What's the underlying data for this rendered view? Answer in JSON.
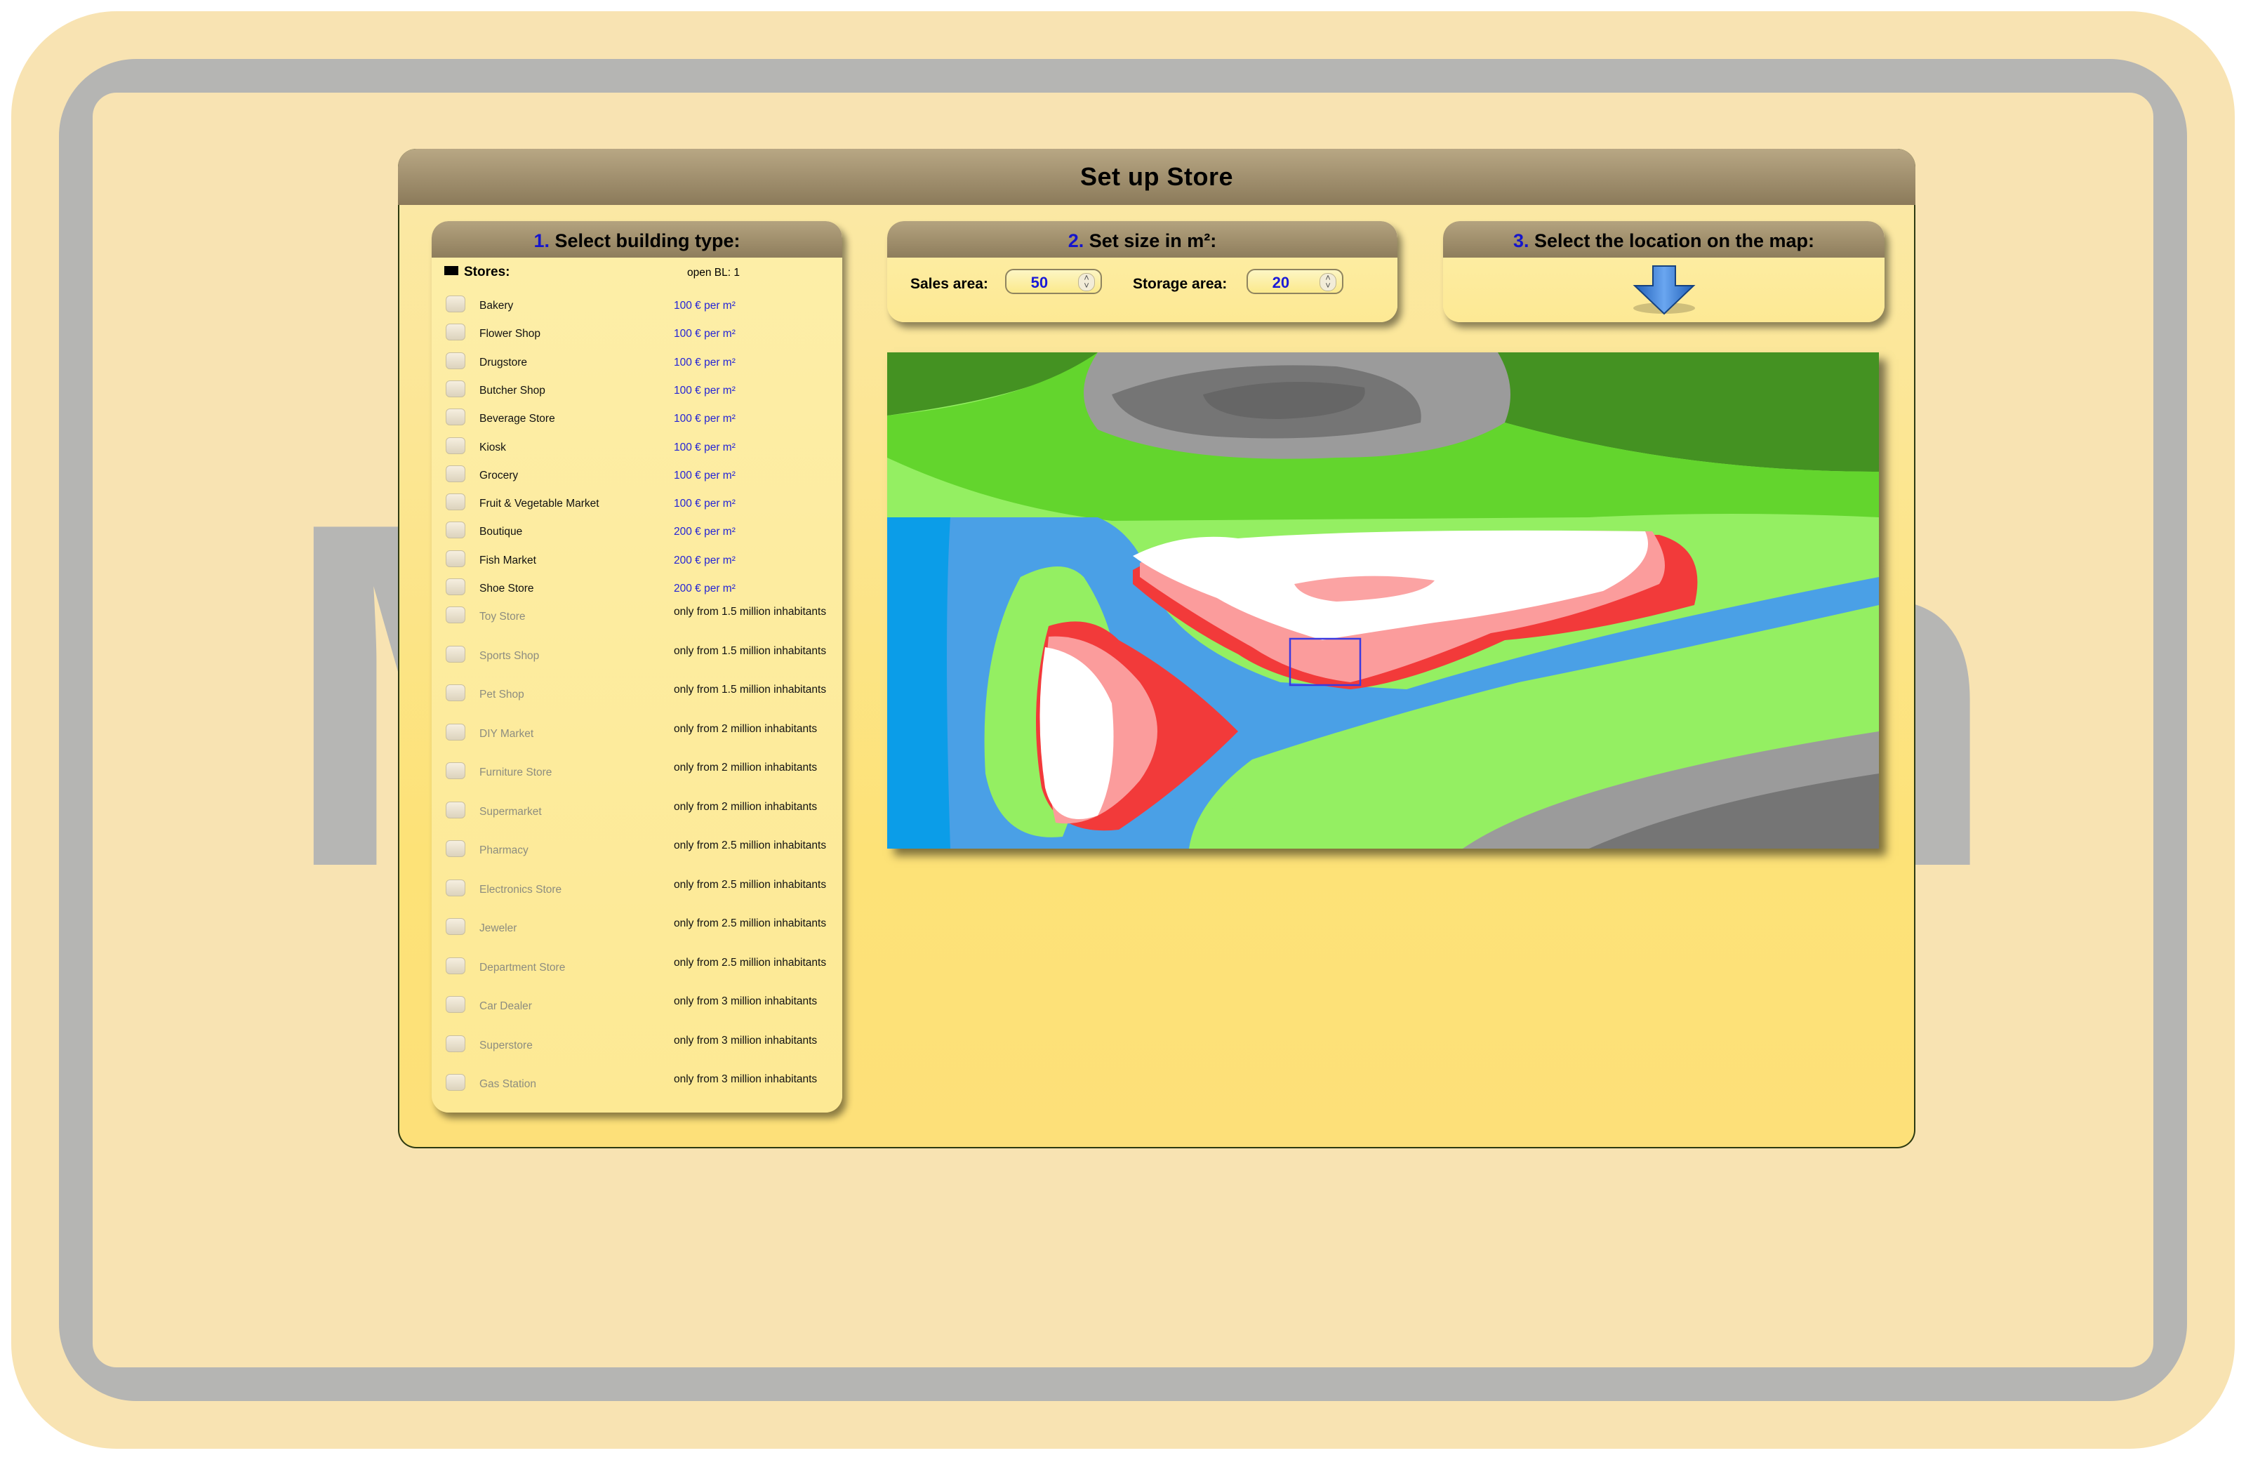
{
  "window": {
    "title": "Set up Store"
  },
  "background_logo": {
    "left_letter": "M",
    "right_letter": "n"
  },
  "step1": {
    "number": "1.",
    "title": "Select building type:",
    "group_label": "Stores:",
    "group_info": "open BL: 1",
    "stores": [
      {
        "name": "Bakery",
        "price": "100 € per m²",
        "locked": false
      },
      {
        "name": "Flower Shop",
        "price": "100 € per m²",
        "locked": false
      },
      {
        "name": "Drugstore",
        "price": "100 € per m²",
        "locked": false
      },
      {
        "name": "Butcher Shop",
        "price": "100 € per m²",
        "locked": false
      },
      {
        "name": "Beverage Store",
        "price": "100 € per m²",
        "locked": false
      },
      {
        "name": "Kiosk",
        "price": "100 € per m²",
        "locked": false
      },
      {
        "name": "Grocery",
        "price": "100 € per m²",
        "locked": false
      },
      {
        "name": "Fruit & Vegetable Market",
        "price": "100 € per m²",
        "locked": false
      },
      {
        "name": "Boutique",
        "price": "200 € per m²",
        "locked": false
      },
      {
        "name": "Fish Market",
        "price": "200 € per m²",
        "locked": false
      },
      {
        "name": "Shoe Store",
        "price": "200 € per m²",
        "locked": false
      },
      {
        "name": "Toy Store",
        "price": "only from 1.5 million inhabitants",
        "locked": true
      },
      {
        "name": "Sports Shop",
        "price": "only from 1.5 million inhabitants",
        "locked": true
      },
      {
        "name": "Pet Shop",
        "price": "only from 1.5 million inhabitants",
        "locked": true
      },
      {
        "name": "DIY Market",
        "price": "only from 2 million inhabitants",
        "locked": true
      },
      {
        "name": "Furniture Store",
        "price": "only from 2 million inhabitants",
        "locked": true
      },
      {
        "name": "Supermarket",
        "price": "only from 2 million inhabitants",
        "locked": true
      },
      {
        "name": "Pharmacy",
        "price": "only from 2.5 million inhabitants",
        "locked": true
      },
      {
        "name": "Electronics Store",
        "price": "only from 2.5 million inhabitants",
        "locked": true
      },
      {
        "name": "Jeweler",
        "price": "only from 2.5 million inhabitants",
        "locked": true
      },
      {
        "name": "Department Store",
        "price": "only from 2.5 million inhabitants",
        "locked": true
      },
      {
        "name": "Car Dealer",
        "price": "only from 3 million inhabitants",
        "locked": true
      },
      {
        "name": "Superstore",
        "price": "only from 3 million inhabitants",
        "locked": true
      },
      {
        "name": "Gas Station",
        "price": "only from 3 million inhabitants",
        "locked": true
      }
    ]
  },
  "step2": {
    "number": "2.",
    "title": "Set size in m²:",
    "sales_label": "Sales area:",
    "sales_value": "50",
    "storage_label": "Storage area:",
    "storage_value": "20"
  },
  "step3": {
    "number": "3.",
    "title": "Select the location on the map:",
    "icon": "arrow-down-icon"
  },
  "colors": {
    "accent_blue": "#1515cc",
    "price_blue": "#2424d6",
    "panel_header": "#9f8e6c",
    "window_bg": "#fde277"
  }
}
